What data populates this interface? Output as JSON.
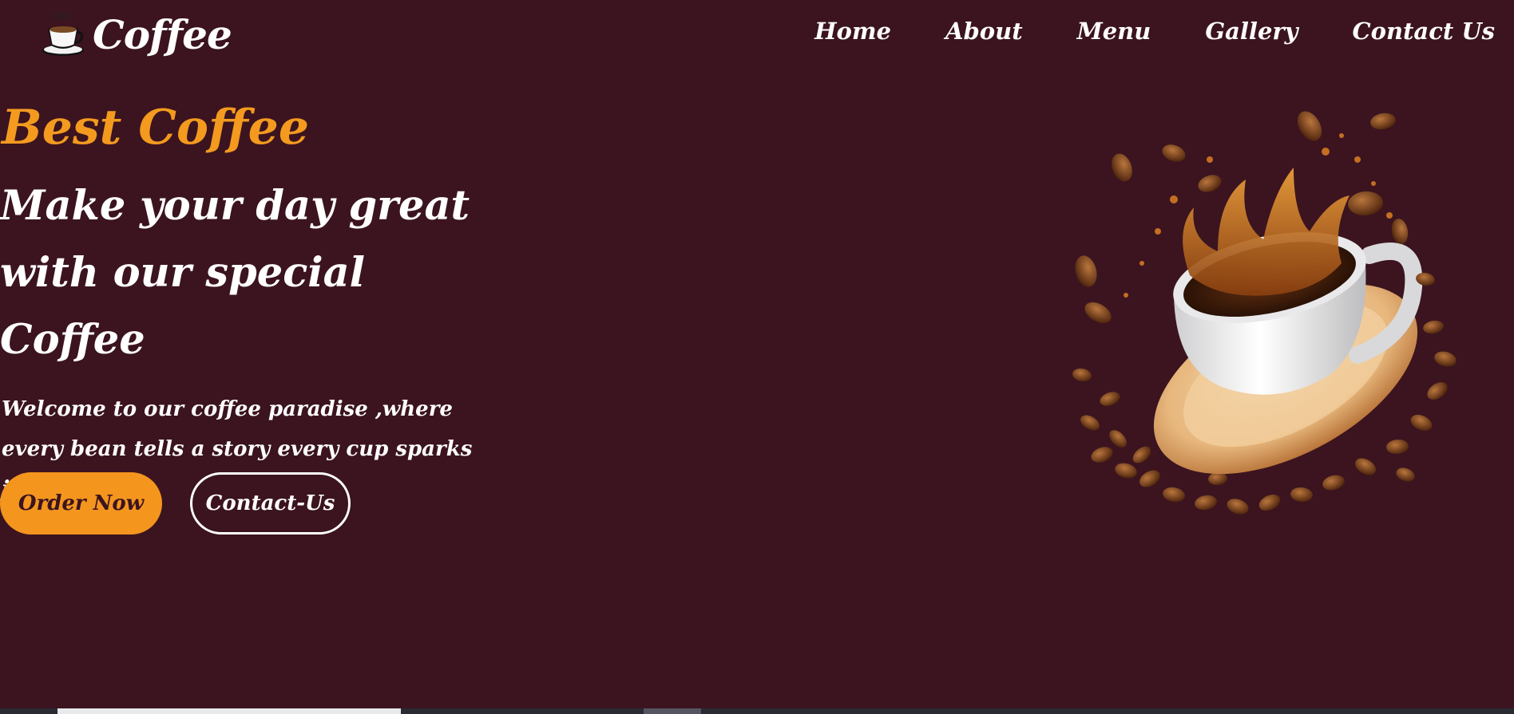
{
  "header": {
    "logo_text": "Coffee",
    "logo_icon": "coffee-cup-icon",
    "nav": [
      "Home",
      "About",
      "Menu",
      "Gallery",
      "Contact Us"
    ]
  },
  "hero": {
    "tagline": "Best Coffee",
    "heading": "Make your day great with our special Coffee",
    "description": "Welcome to our coffee paradise ,where every bean tells a story every cup sparks joy.",
    "primary_button": "Order Now",
    "secondary_button": "Contact-Us",
    "image_icon": "coffee-splash-illustration"
  },
  "colors": {
    "background": "#3b141f",
    "accent": "#f39a1f",
    "text": "#ffffff"
  }
}
